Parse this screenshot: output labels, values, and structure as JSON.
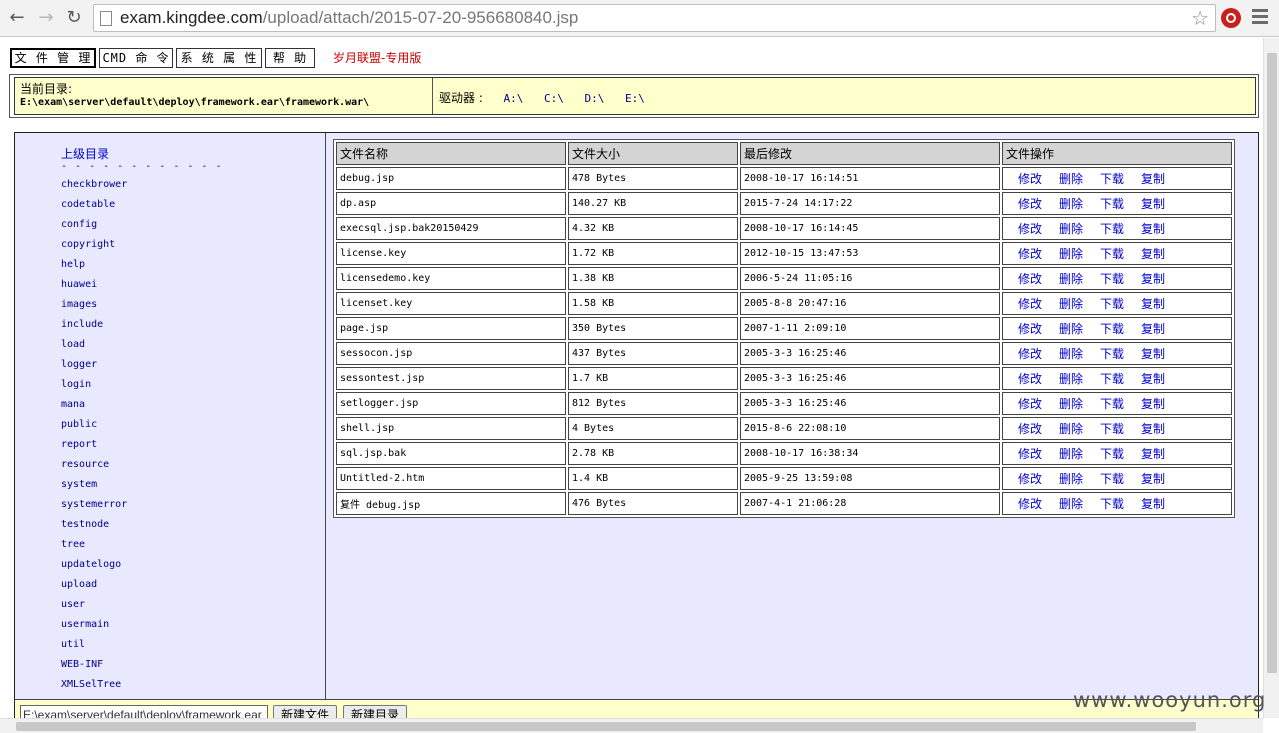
{
  "browser": {
    "url_host": "exam.kingdee.com",
    "url_path": "/upload/attach/2015-07-20-956680840.jsp",
    "back_icon": "arrow-left",
    "forward_icon": "arrow-right",
    "reload_icon": "reload",
    "star_icon": "star",
    "extension_icon": "power-button",
    "menu_icon": "hamburger"
  },
  "topmenu": {
    "file_manager": "文 件 管 理",
    "cmd": "CMD 命 令",
    "sys_props": "系 统 属 性",
    "help": "帮 助",
    "brand": "岁月联盟-专用版"
  },
  "path": {
    "current_label": "当前目录:",
    "current_value": "E:\\exam\\server\\default\\deploy\\framework.ear\\framework.war\\",
    "drives_label": "驱动器 :",
    "drives": [
      "A:\\",
      "C:\\",
      "D:\\",
      "E:\\"
    ]
  },
  "sidebar": {
    "parent_dir": "上级目录",
    "dashes": "- - - - - - - - - - - -",
    "dirs": [
      "checkbrower",
      "codetable",
      "config",
      "copyright",
      "help",
      "huawei",
      "images",
      "include",
      "load",
      "logger",
      "login",
      "mana",
      "public",
      "report",
      "resource",
      "system",
      "systemerror",
      "testnode",
      "tree",
      "updatelogo",
      "upload",
      "user",
      "usermain",
      "util",
      "WEB-INF",
      "XMLSelTree"
    ]
  },
  "table": {
    "headers": [
      "文件名称",
      "文件大小",
      "最后修改",
      "文件操作"
    ],
    "ops": [
      "修改",
      "删除",
      "下载",
      "复制"
    ],
    "rows": [
      {
        "name": "debug.jsp",
        "size": "478 Bytes",
        "modified": "2008-10-17 16:14:51"
      },
      {
        "name": "dp.asp",
        "size": "140.27 KB",
        "modified": "2015-7-24 14:17:22"
      },
      {
        "name": "execsql.jsp.bak20150429",
        "size": "4.32 KB",
        "modified": "2008-10-17 16:14:45"
      },
      {
        "name": "license.key",
        "size": "1.72 KB",
        "modified": "2012-10-15 13:47:53"
      },
      {
        "name": "licensedemo.key",
        "size": "1.38 KB",
        "modified": "2006-5-24 11:05:16"
      },
      {
        "name": "licenset.key",
        "size": "1.58 KB",
        "modified": "2005-8-8 20:47:16"
      },
      {
        "name": "page.jsp",
        "size": "350 Bytes",
        "modified": "2007-1-11 2:09:10"
      },
      {
        "name": "sessocon.jsp",
        "size": "437 Bytes",
        "modified": "2005-3-3 16:25:46"
      },
      {
        "name": "sessontest.jsp",
        "size": "1.7 KB",
        "modified": "2005-3-3 16:25:46"
      },
      {
        "name": "setlogger.jsp",
        "size": "812 Bytes",
        "modified": "2005-3-3 16:25:46"
      },
      {
        "name": "shell.jsp",
        "size": "4 Bytes",
        "modified": "2015-8-6 22:08:10"
      },
      {
        "name": "sql.jsp.bak",
        "size": "2.78 KB",
        "modified": "2008-10-17 16:38:34"
      },
      {
        "name": "Untitled-2.htm",
        "size": "1.4 KB",
        "modified": "2005-9-25 13:59:08"
      },
      {
        "name": "复件 debug.jsp",
        "size": "476 Bytes",
        "modified": "2007-4-1 21:06:28"
      }
    ]
  },
  "footer": {
    "path_input_value": "E:\\exam\\server\\default\\deploy\\framework.ear",
    "new_file": "新建文件",
    "new_dir": "新建目录"
  },
  "watermark": "www.wooyun.org",
  "colors": {
    "panel_yellow": "#ffffcc",
    "main_lavender": "#e8e8ff",
    "link_blue": "#0000cc",
    "brand_red": "#cc0000"
  }
}
